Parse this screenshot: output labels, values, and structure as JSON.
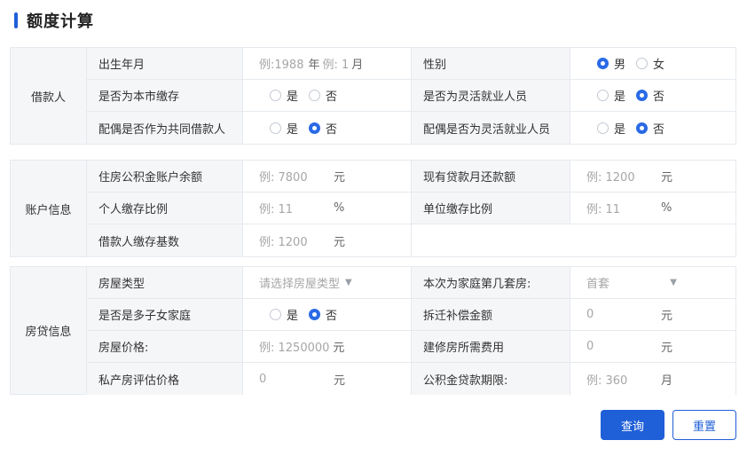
{
  "page_title": "额度计算",
  "borrower": {
    "section_label": "借款人",
    "birth_label": "出生年月",
    "birth_year_placeholder": "例:1988",
    "birth_year_unit": "年",
    "birth_month_placeholder": "例: 1",
    "birth_month_unit": "月",
    "gender_label": "性别",
    "gender_male": "男",
    "gender_female": "女",
    "local_deposit_label": "是否为本市缴存",
    "flexible_label": "是否为灵活就业人员",
    "spouse_coborrower_label": "配偶是否作为共同借款人",
    "spouse_flexible_label": "配偶是否为灵活就业人员",
    "yes": "是",
    "no": "否"
  },
  "account": {
    "section_label": "账户信息",
    "balance_label": "住房公积金账户余额",
    "balance_placeholder": "例: 7800",
    "balance_unit": "元",
    "monthly_repay_label": "现有贷款月还款额",
    "monthly_repay_placeholder": "例: 1200",
    "monthly_repay_unit": "元",
    "personal_ratio_label": "个人缴存比例",
    "personal_ratio_placeholder": "例: 11",
    "personal_ratio_unit": "%",
    "employer_ratio_label": "单位缴存比例",
    "employer_ratio_placeholder": "例: 11",
    "employer_ratio_unit": "%",
    "base_label": "借款人缴存基数",
    "base_placeholder": "例: 1200",
    "base_unit": "元"
  },
  "loan": {
    "section_label": "房贷信息",
    "house_type_label": "房屋类型",
    "house_type_placeholder": "请选择房屋类型",
    "nth_house_label": "本次为家庭第几套房:",
    "nth_house_value": "首套",
    "multi_child_label": "是否是多子女家庭",
    "relocation_label": "拆迁补偿金额",
    "relocation_placeholder": "0",
    "relocation_unit": "元",
    "price_label": "房屋价格:",
    "price_placeholder": "例: 1250000",
    "price_unit": "元",
    "construction_label": "建修房所需费用",
    "construction_placeholder": "0",
    "construction_unit": "元",
    "private_eval_label": "私产房评估价格",
    "private_eval_placeholder": "0",
    "private_eval_unit": "元",
    "term_label": "公积金贷款期限:",
    "term_placeholder": "例: 360",
    "term_unit": "月",
    "yes": "是",
    "no": "否"
  },
  "actions": {
    "query_label": "查询",
    "reset_label": "重置"
  },
  "colors": {
    "accent": "#1f5fd8",
    "label_bg": "#f5f6f8",
    "border": "#e6e9ef",
    "placeholder": "#a6a6a6"
  }
}
